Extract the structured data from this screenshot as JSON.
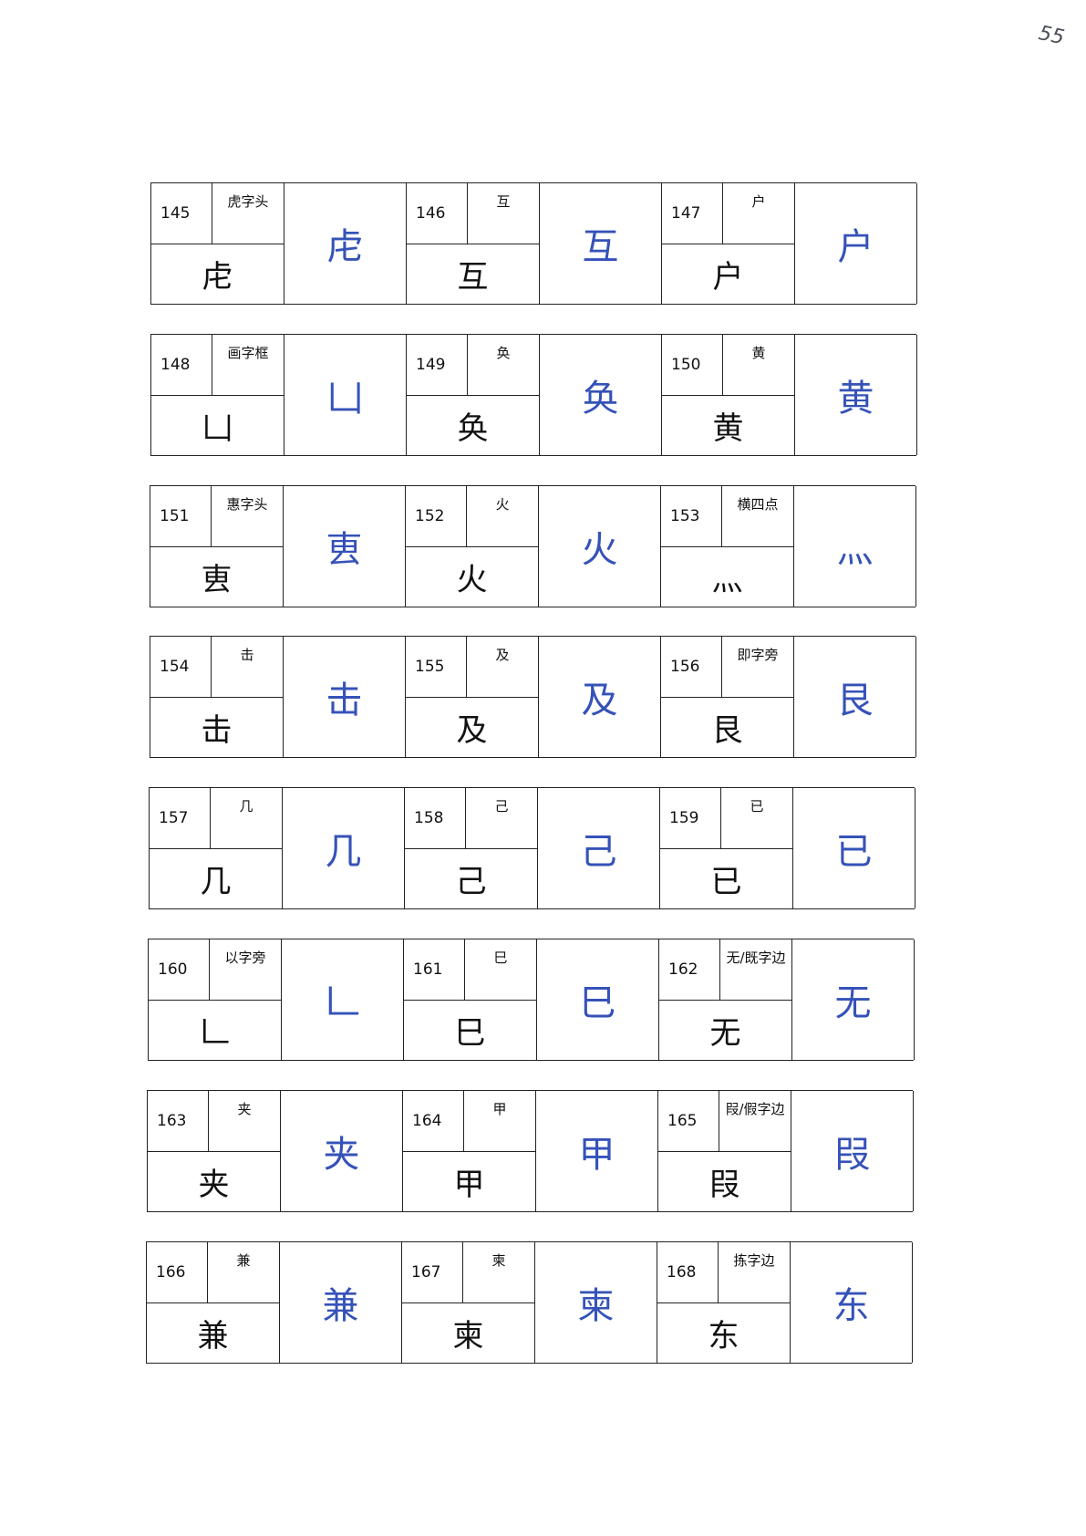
{
  "page_number": "55",
  "rows": [
    [
      {
        "num": "145",
        "name": "虎字头",
        "glyph": "虍",
        "hand": "虍",
        "hand_empty": false
      },
      {
        "num": "146",
        "name": "互",
        "glyph": "互",
        "hand": "互",
        "hand_empty": false
      },
      {
        "num": "147",
        "name": "户",
        "glyph": "户",
        "hand": "户",
        "hand_empty": false
      }
    ],
    [
      {
        "num": "148",
        "name": "画字框",
        "glyph": "凵",
        "hand": "凵",
        "hand_empty": false
      },
      {
        "num": "149",
        "name": "奂",
        "glyph": "奂",
        "hand": "奂",
        "hand_empty": false
      },
      {
        "num": "150",
        "name": "黄",
        "glyph": "黄",
        "hand": "黄",
        "hand_empty": false
      }
    ],
    [
      {
        "num": "151",
        "name": "惠字头",
        "glyph": "叀",
        "hand": "叀",
        "hand_empty": false
      },
      {
        "num": "152",
        "name": "火",
        "glyph": "火",
        "hand": "火",
        "hand_empty": false
      },
      {
        "num": "153",
        "name": "横四点",
        "glyph": "灬",
        "hand": "灬",
        "hand_empty": false
      }
    ],
    [
      {
        "num": "154",
        "name": "击",
        "glyph": "击",
        "hand": "击",
        "hand_empty": false
      },
      {
        "num": "155",
        "name": "及",
        "glyph": "及",
        "hand": "及",
        "hand_empty": false
      },
      {
        "num": "156",
        "name": "即字旁",
        "glyph": "艮",
        "hand": "艮",
        "hand_empty": false
      }
    ],
    [
      {
        "num": "157",
        "name": "几",
        "glyph": "几",
        "hand": "几",
        "hand_empty": false
      },
      {
        "num": "158",
        "name": "己",
        "glyph": "己",
        "hand": "己",
        "hand_empty": false
      },
      {
        "num": "159",
        "name": "已",
        "glyph": "已",
        "hand": "已",
        "hand_empty": false
      }
    ],
    [
      {
        "num": "160",
        "name": "以字旁",
        "glyph": "𠃊",
        "hand": "𠃊",
        "hand_empty": false
      },
      {
        "num": "161",
        "name": "巳",
        "glyph": "巳",
        "hand": "巳",
        "hand_empty": false
      },
      {
        "num": "162",
        "name": "无/既字边",
        "glyph": "无",
        "hand": "无",
        "hand_empty": false
      }
    ],
    [
      {
        "num": "163",
        "name": "夹",
        "glyph": "夹",
        "hand": "夹",
        "hand_empty": false
      },
      {
        "num": "164",
        "name": "甲",
        "glyph": "甲",
        "hand": "甲",
        "hand_empty": false
      },
      {
        "num": "165",
        "name": "叚/假字边",
        "glyph": "叚",
        "hand": "叚",
        "hand_empty": false
      }
    ],
    [
      {
        "num": "166",
        "name": "兼",
        "glyph": "兼",
        "hand": "兼",
        "hand_empty": false
      },
      {
        "num": "167",
        "name": "柬",
        "glyph": "柬",
        "hand": "柬",
        "hand_empty": false
      },
      {
        "num": "168",
        "name": "拣字边",
        "glyph": "东",
        "hand": "东",
        "hand_empty": false
      }
    ]
  ]
}
